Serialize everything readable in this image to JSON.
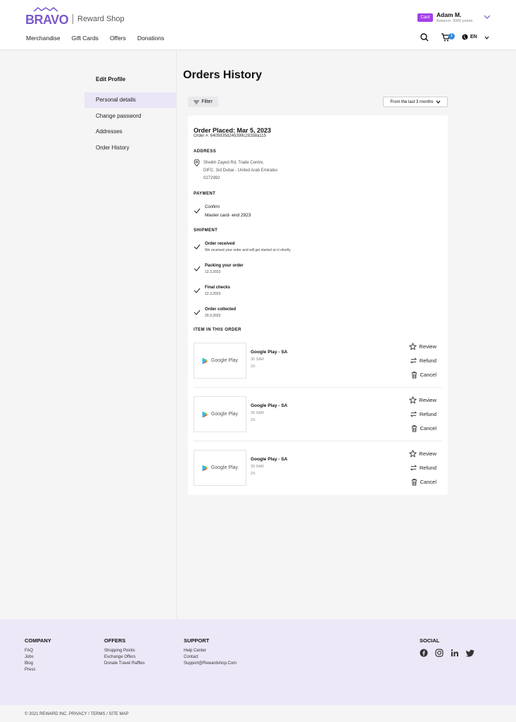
{
  "header": {
    "logo_text": "BRAVO",
    "shop_name": "Reward Shop",
    "nav": [
      "Merchandise",
      "Gift Cards",
      "Offers",
      "Donations"
    ],
    "card_label": "Card",
    "user_name": "Adam M.",
    "user_balance": "Balance: 3000 points",
    "cart_count": "1",
    "language": "EN",
    "accent_color": "#7b58c9",
    "badge_color": "#a540e8"
  },
  "sidebar": {
    "title": "Edit Profile",
    "items": [
      {
        "label": "Personal details",
        "active": true
      },
      {
        "label": "Change password",
        "active": false
      },
      {
        "label": "Addresses",
        "active": false
      },
      {
        "label": "Order History",
        "active": false
      }
    ]
  },
  "main": {
    "title": "Orders History",
    "filter_label": "Filter",
    "range_label": "From the last 3 months",
    "order": {
      "placed": "Order Placed: Mar 5, 2023",
      "number": "Order #: 6405935d245399c282b8a115",
      "address_heading": "ADDRESS",
      "address_lines": [
        "Sheikh Zayed Rd, Trade Centre,",
        "DIFC, 3rd Dubai - United Arab Emirates",
        "0272992"
      ],
      "payment_heading": "PAYMENT",
      "payment_status": "Confirm",
      "payment_method": "Master card- end 2923",
      "shipment_heading": "SHIPMENT",
      "steps": [
        {
          "title": "Order received",
          "sub": "We received your order and will get started on it shortly"
        },
        {
          "title": "Packing your order",
          "sub": "12.3.2023"
        },
        {
          "title": "Final checks",
          "sub": "12.3.2023"
        },
        {
          "title": "Order collected",
          "sub": "20.3.2023"
        }
      ],
      "items_heading": "ITEM IN THIS ORDER",
      "items": [
        {
          "brand": "Google Play",
          "name": "Google Play - SA",
          "price": "30 SAR",
          "qty": "2X"
        },
        {
          "brand": "Google Play",
          "name": "Google Play - SA",
          "price": "30 SAR",
          "qty": "2X"
        },
        {
          "brand": "Google Play",
          "name": "Google Play - SA",
          "price": "30 SAR",
          "qty": "2X"
        }
      ],
      "actions": {
        "review": "Review",
        "refund": "Refund",
        "cancel": "Cancel"
      }
    }
  },
  "footer": {
    "company": {
      "heading": "COMPANY",
      "links": [
        "FAQ",
        "Jobs",
        "Blog",
        "Press"
      ]
    },
    "offers": {
      "heading": "OFFERS",
      "links": [
        "Shopping Points",
        "Exchange Offers",
        "Donate Travel Raffles"
      ]
    },
    "support": {
      "heading": "SUPPORT",
      "links": [
        "Help Center",
        "Contact",
        "Support@Rewardshop.Com"
      ]
    },
    "social": {
      "heading": "SOCIAL",
      "icons": [
        "facebook-icon",
        "instagram-icon",
        "linkedin-icon",
        "twitter-icon"
      ]
    },
    "copyright": "© 2021 REWARD INC. PRIVACY / TERMS / SITE MAP"
  }
}
